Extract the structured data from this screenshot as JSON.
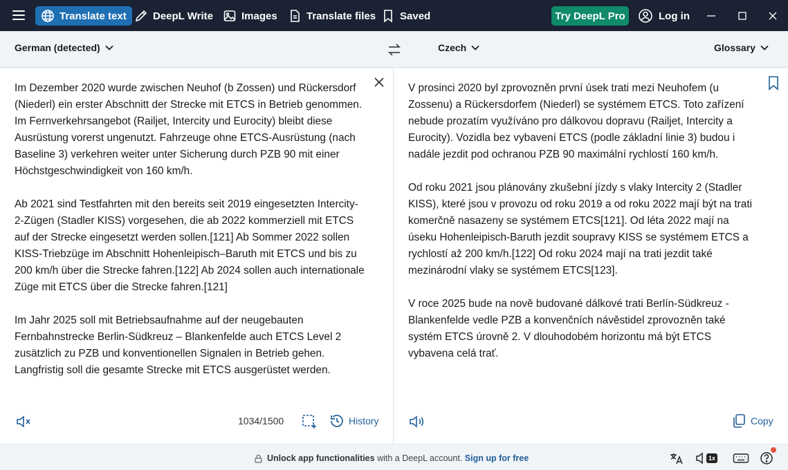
{
  "topbar": {
    "nav": [
      {
        "label": "Translate text",
        "icon": "globe-icon",
        "active": true
      },
      {
        "label": "DeepL Write",
        "icon": "pen-icon",
        "active": false
      },
      {
        "label": "Images",
        "icon": "image-icon",
        "active": false
      },
      {
        "label": "Translate files",
        "icon": "file-icon",
        "active": false
      },
      {
        "label": "Saved",
        "icon": "bookmark-icon",
        "active": false
      }
    ],
    "try_pro": "Try DeepL Pro",
    "login": "Log in"
  },
  "langbar": {
    "source_lang": "German (detected)",
    "target_lang": "Czech",
    "glossary": "Glossary"
  },
  "source": {
    "paragraphs": [
      "Im Dezember 2020 wurde zwischen Neuhof (b Zossen) und Rückersdorf (Niederl) ein erster Abschnitt der Strecke mit ETCS in Betrieb genommen. Im Fernverkehrsangebot (Railjet, Intercity und Eurocity) bleibt diese Ausrüstung vorerst ungenutzt. Fahrzeuge ohne ETCS-Ausrüstung (nach Baseline 3) verkehren weiter unter Sicherung durch PZB 90 mit einer Höchstgeschwindigkeit von 160 km/h.",
      "Ab 2021 sind Testfahrten mit den bereits seit 2019 eingesetzten Intercity-2-Zügen (Stadler KISS) vorgesehen, die ab 2022 kommerziell mit ETCS auf der Strecke eingesetzt werden sollen.[121] Ab Sommer 2022 sollen KISS-Triebzüge im Abschnitt Hohenleipisch–Baruth mit ETCS und bis zu 200 km/h über die Strecke fahren.[122] Ab 2024 sollen auch internationale Züge mit ETCS über die Strecke fahren.[121]",
      "Im Jahr 2025 soll mit Betriebsaufnahme auf der neugebauten Fernbahnstrecke Berlin-Südkreuz – Blankenfelde auch ETCS Level 2 zusätzlich zu PZB und konventionellen Signalen in Betrieb gehen. Langfristig soll die gesamte Strecke mit ETCS ausgerüstet werden."
    ],
    "char_count": "1034/1500",
    "history": "History"
  },
  "target": {
    "paragraphs": [
      "V prosinci 2020 byl zprovozněn první úsek trati mezi Neuhofem (u Zossenu) a Rückersdorfem (Niederl) se systémem ETCS. Toto zařízení nebude prozatím využíváno pro dálkovou dopravu (Railjet, Intercity a Eurocity). Vozidla bez vybavení ETCS (podle základní linie 3) budou i nadále jezdit pod ochranou PZB 90 maximální rychlostí 160 km/h.",
      "Od roku 2021 jsou plánovány zkušební jízdy s vlaky Intercity 2 (Stadler KISS), které jsou v provozu od roku 2019 a od roku 2022 mají být na trati komerčně nasazeny se systémem ETCS[121]. Od léta 2022 mají na úseku Hohenleipisch-Baruth jezdit soupravy KISS se systémem ETCS a rychlostí až 200 km/h.[122] Od roku 2024 mají na trati jezdit také mezinárodní vlaky se systémem ETCS[123].",
      "V roce 2025 bude na nově budované dálkové trati Berlín-Südkreuz - Blankenfelde vedle PZB a konvenčních návěstidel zprovozněn také systém ETCS úrovně 2. V dlouhodobém horizontu má být ETCS vybavena celá trať."
    ],
    "copy": "Copy"
  },
  "bottombar": {
    "unlock_bold": "Unlock app functionalities",
    "unlock_text": "with a DeepL account.",
    "signup": "Sign up for free",
    "speed": "1x"
  },
  "colors": {
    "topbar_bg": "#1a2233",
    "active_tab": "#1f6fb3",
    "pro_button": "#0f8a6a",
    "link": "#1f5f99"
  }
}
